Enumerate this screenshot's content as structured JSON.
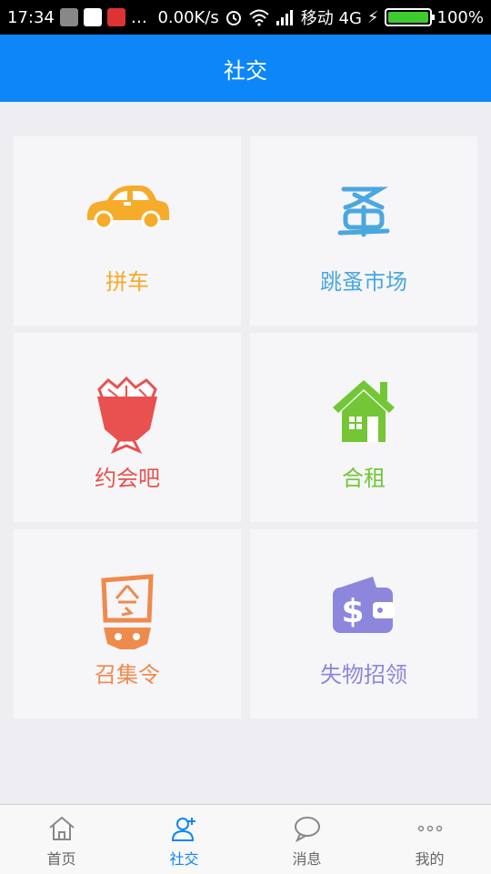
{
  "status_bar": {
    "time": "17:34",
    "network_speed": "0.00K/s",
    "carrier": "移动 4G",
    "battery": "100%",
    "battery_level": 1.0
  },
  "header": {
    "title": "社交"
  },
  "tiles": [
    {
      "label": "拼车",
      "icon": "car-icon",
      "color": "#f6ab2a"
    },
    {
      "label": "跳蚤市场",
      "icon": "flea-market-icon",
      "color": "#4aa7e0"
    },
    {
      "label": "约会吧",
      "icon": "flower-bouquet-icon",
      "color": "#e8514f"
    },
    {
      "label": "合租",
      "icon": "house-icon",
      "color": "#73c636"
    },
    {
      "label": "召集令",
      "icon": "summon-token-icon",
      "color": "#ef8a4d"
    },
    {
      "label": "失物招领",
      "icon": "wallet-icon",
      "color": "#8d86dd"
    }
  ],
  "tabbar": {
    "items": [
      {
        "label": "首页",
        "icon": "home-icon",
        "active": false
      },
      {
        "label": "社交",
        "icon": "social-icon",
        "active": true
      },
      {
        "label": "消息",
        "icon": "chat-icon",
        "active": false
      },
      {
        "label": "我的",
        "icon": "more-icon",
        "active": false
      }
    ],
    "active_color": "#0d86f7"
  }
}
